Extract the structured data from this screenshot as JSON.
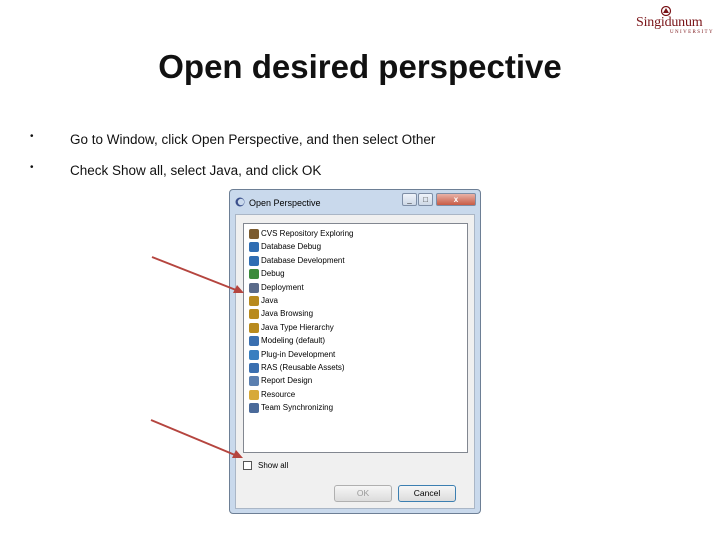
{
  "brand": {
    "name": "Singidunum",
    "subtitle": "UNIVERSITY",
    "color": "#7a1418"
  },
  "slide": {
    "title": "Open desired perspective",
    "bullets": [
      "Go to Window, click Open Perspective, and then select  Other",
      "Check Show all, select Java, and click OK"
    ],
    "bullet_glyph": "•"
  },
  "dialog": {
    "title": "Open Perspective",
    "window_buttons": {
      "minimize": "_",
      "maximize": "□",
      "close": "x"
    },
    "perspectives": [
      {
        "label": "CVS Repository Exploring",
        "icon": "cvs-icon"
      },
      {
        "label": "Database Debug",
        "icon": "database-debug-icon"
      },
      {
        "label": "Database Development",
        "icon": "database-development-icon"
      },
      {
        "label": "Debug",
        "icon": "debug-icon"
      },
      {
        "label": "Deployment",
        "icon": "deployment-icon"
      },
      {
        "label": "Java",
        "icon": "java-icon"
      },
      {
        "label": "Java Browsing",
        "icon": "java-browsing-icon"
      },
      {
        "label": "Java Type Hierarchy",
        "icon": "java-type-hierarchy-icon"
      },
      {
        "label": "Modeling (default)",
        "icon": "modeling-icon"
      },
      {
        "label": "Plug-in Development",
        "icon": "plugin-development-icon"
      },
      {
        "label": "RAS (Reusable Assets)",
        "icon": "ras-icon"
      },
      {
        "label": "Report Design",
        "icon": "report-design-icon"
      },
      {
        "label": "Resource",
        "icon": "resource-icon"
      },
      {
        "label": "Team Synchronizing",
        "icon": "team-synchronizing-icon"
      }
    ],
    "show_all_label": "Show all",
    "show_all_checked": false,
    "ok_label": "OK",
    "ok_enabled": false,
    "cancel_label": "Cancel"
  },
  "colors": {
    "arrow": "#b5453f",
    "titlebar": "#c9d9ec"
  }
}
